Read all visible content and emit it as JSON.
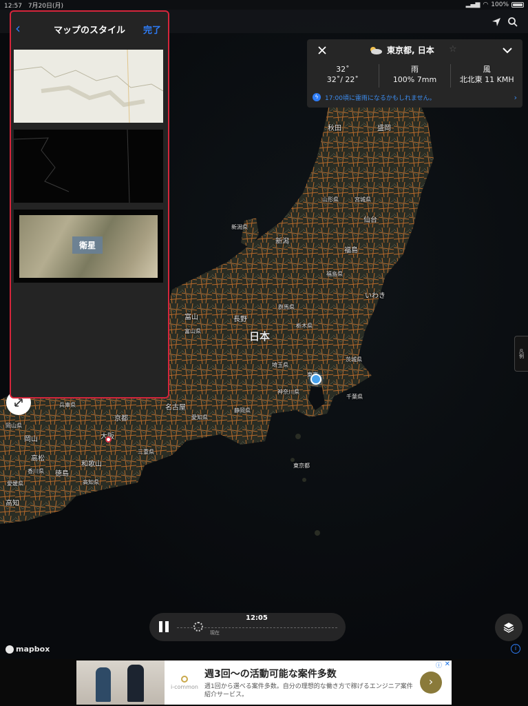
{
  "status_bar": {
    "time": "12:57",
    "date": "7月20日(月)",
    "battery": "100%"
  },
  "style_panel": {
    "title": "マップのスタイル",
    "done_label": "完了",
    "tiles": [
      {
        "style": "light",
        "label": ""
      },
      {
        "style": "dark",
        "label": ""
      },
      {
        "style": "satellite",
        "label": "衛星"
      }
    ]
  },
  "weather": {
    "location": "東京都, 日本",
    "temp_label": "32˚",
    "temp_range": "32˚/ 22˚",
    "rain_label": "雨",
    "rain_value": "100% 7mm",
    "wind_label": "風",
    "wind_value": "北北東 11 KMH",
    "alert": "17:00頃に雷雨になるかもしれません。"
  },
  "map_labels": {
    "country": "日本",
    "cities": [
      {
        "name": "秋田"
      },
      {
        "name": "盛岡"
      },
      {
        "name": "山形県"
      },
      {
        "name": "宮城県"
      },
      {
        "name": "仙台"
      },
      {
        "name": "新潟県"
      },
      {
        "name": "新潟"
      },
      {
        "name": "福島"
      },
      {
        "name": "福島県"
      },
      {
        "name": "いわき"
      },
      {
        "name": "群馬県"
      },
      {
        "name": "栃木県"
      },
      {
        "name": "長野"
      },
      {
        "name": "富山"
      },
      {
        "name": "富山県"
      },
      {
        "name": "茨城県"
      },
      {
        "name": "埼玉県"
      },
      {
        "name": "東京"
      },
      {
        "name": "神奈川県"
      },
      {
        "name": "千葉県"
      },
      {
        "name": "静岡県"
      },
      {
        "name": "名古屋"
      },
      {
        "name": "愛知県"
      },
      {
        "name": "京都"
      },
      {
        "name": "大阪"
      },
      {
        "name": "三重県"
      },
      {
        "name": "岡山"
      },
      {
        "name": "岡山県"
      },
      {
        "name": "高松"
      },
      {
        "name": "和歌山"
      },
      {
        "name": "香川県"
      },
      {
        "name": "徳島"
      },
      {
        "name": "愛媛県"
      },
      {
        "name": "高知"
      },
      {
        "name": "兵庫県"
      },
      {
        "name": "東京都"
      },
      {
        "name": "高知県"
      }
    ]
  },
  "side_tab_label": "凡例",
  "timeline": {
    "time": "12:05",
    "now_label": "現在"
  },
  "attribution": "mapbox",
  "ad": {
    "brand": "i-common",
    "headline": "週3回〜の活動可能な案件多数",
    "body": "週1回から選べる案件多数。自分の理想的な働き方で稼げるエンジニア案件紹介サービス。"
  }
}
